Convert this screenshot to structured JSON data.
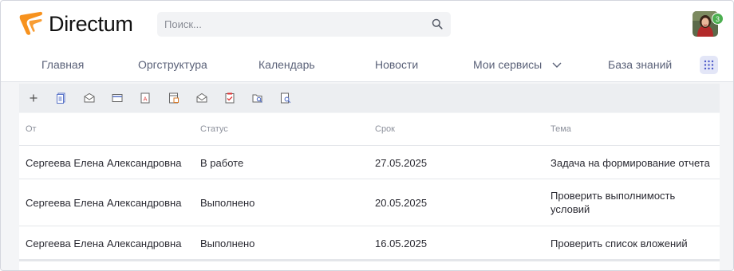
{
  "brand": {
    "name": "Directum",
    "accent": "#f7921e"
  },
  "search": {
    "placeholder": "Поиск..."
  },
  "user": {
    "notifications": "3"
  },
  "nav": {
    "items": [
      "Главная",
      "Оргструктура",
      "Календарь",
      "Новости",
      "Мои сервисы",
      "База знаний"
    ]
  },
  "toolbar": {
    "icons": [
      "plus-icon",
      "documents-icon",
      "envelope-icon",
      "card-icon",
      "pdf-document-icon",
      "document-image-icon",
      "envelope-open-icon",
      "checklist-icon",
      "folder-search-icon",
      "document-search-icon"
    ]
  },
  "table": {
    "columns": [
      "От",
      "Статус",
      "Срок",
      "Тема"
    ],
    "rows": [
      {
        "from": "Сергеева Елена Александровна",
        "status": "В работе",
        "due": "27.05.2025",
        "subject": "Задача на формирование отчета"
      },
      {
        "from": "Сергеева Елена Александровна",
        "status": "Выполнено",
        "due": "20.05.2025",
        "subject": "Проверить выполнимость условий"
      },
      {
        "from": "Сергеева Елена Александровна",
        "status": "Выполнено",
        "due": "16.05.2025",
        "subject": "Проверить список вложений"
      }
    ]
  }
}
